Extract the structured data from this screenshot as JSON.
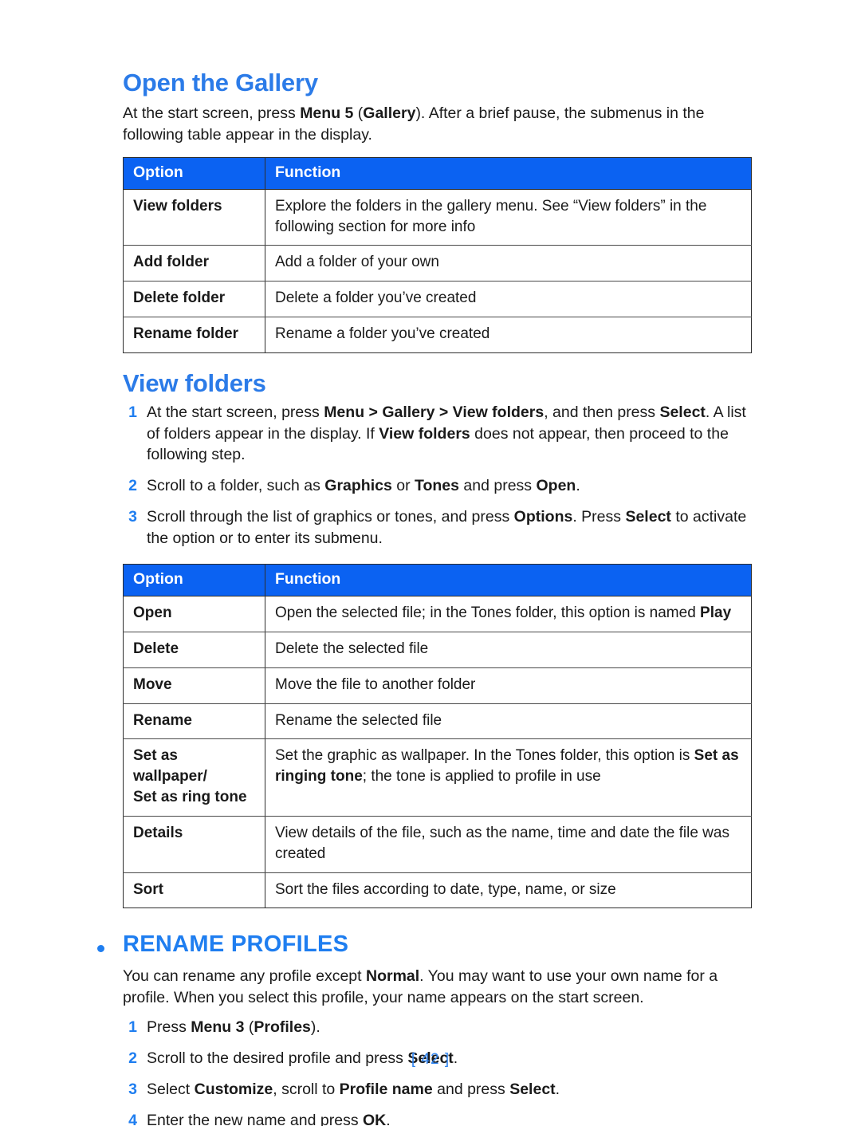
{
  "page": {
    "footer_label": "[ 42 ]",
    "accent_blue": "#2b7be8",
    "table_header_blue": "#0b62f2"
  },
  "gallery_section": {
    "heading": "Open the Gallery",
    "intro_parts": [
      {
        "text": "At the start screen, press ",
        "bold": false
      },
      {
        "text": "Menu 5",
        "bold": true
      },
      {
        "text": " (",
        "bold": false
      },
      {
        "text": "Gallery",
        "bold": true
      },
      {
        "text": "). After a brief pause, the submenus in the following table appear in the display.",
        "bold": false
      }
    ],
    "intro_plain": "At the start screen, press Menu 5 (Gallery). After a brief pause, the submenus in the following table appear in the display.",
    "table": {
      "headers": [
        "Option",
        "Function"
      ],
      "rows": [
        {
          "option": "View folders",
          "function": "Explore the folders in the gallery menu. See “View folders” in the following section for more info"
        },
        {
          "option": "Add folder",
          "function": "Add a folder of your own"
        },
        {
          "option": "Delete folder",
          "function": "Delete a folder you’ve created"
        },
        {
          "option": "Rename folder",
          "function": "Rename a folder you’ve created"
        }
      ]
    }
  },
  "view_folders_section": {
    "heading": "View folders",
    "steps": [
      {
        "num": "1",
        "text": "At the start screen, press Menu > Gallery > View folders, and then press Select. A list of folders appear in the display. If View folders does not appear, then proceed to the following step."
      },
      {
        "num": "2",
        "text": "Scroll to a folder, such as Graphics or Tones and press Open."
      },
      {
        "num": "3",
        "text": "Scroll through the list of graphics or tones, and press Options. Press Select to activate the option or to enter its submenu."
      }
    ],
    "table": {
      "headers": [
        "Option",
        "Function"
      ],
      "rows": [
        {
          "option": "Open",
          "function": "Open the selected file; in the Tones folder, this option is named Play"
        },
        {
          "option": "Delete",
          "function": "Delete the selected file"
        },
        {
          "option": "Move",
          "function": "Move the file to another folder"
        },
        {
          "option": "Rename",
          "function": "Rename the selected file"
        },
        {
          "option": "Set as wallpaper/ Set as ring tone",
          "function": "Set the graphic as wallpaper. In the Tones folder, this option is Set as ringing tone; the tone is applied to profile in use"
        },
        {
          "option": "Details",
          "function": "View details of the file, such as the name, time and date the file was created"
        },
        {
          "option": "Sort",
          "function": "Sort the files according to date, type, name, or size"
        }
      ]
    }
  },
  "rename_profiles_section": {
    "heading": "RENAME PROFILES",
    "intro": "You can rename any profile except Normal. You may want to use your own name for a profile. When you select this profile, your name appears on the start screen.",
    "steps": [
      {
        "num": "1",
        "text": "Press Menu 3 (Profiles)."
      },
      {
        "num": "2",
        "text": "Scroll to the desired profile and press Select."
      },
      {
        "num": "3",
        "text": "Select Customize, scroll to Profile name and press Select."
      },
      {
        "num": "4",
        "text": "Enter the new name and press OK."
      }
    ]
  }
}
